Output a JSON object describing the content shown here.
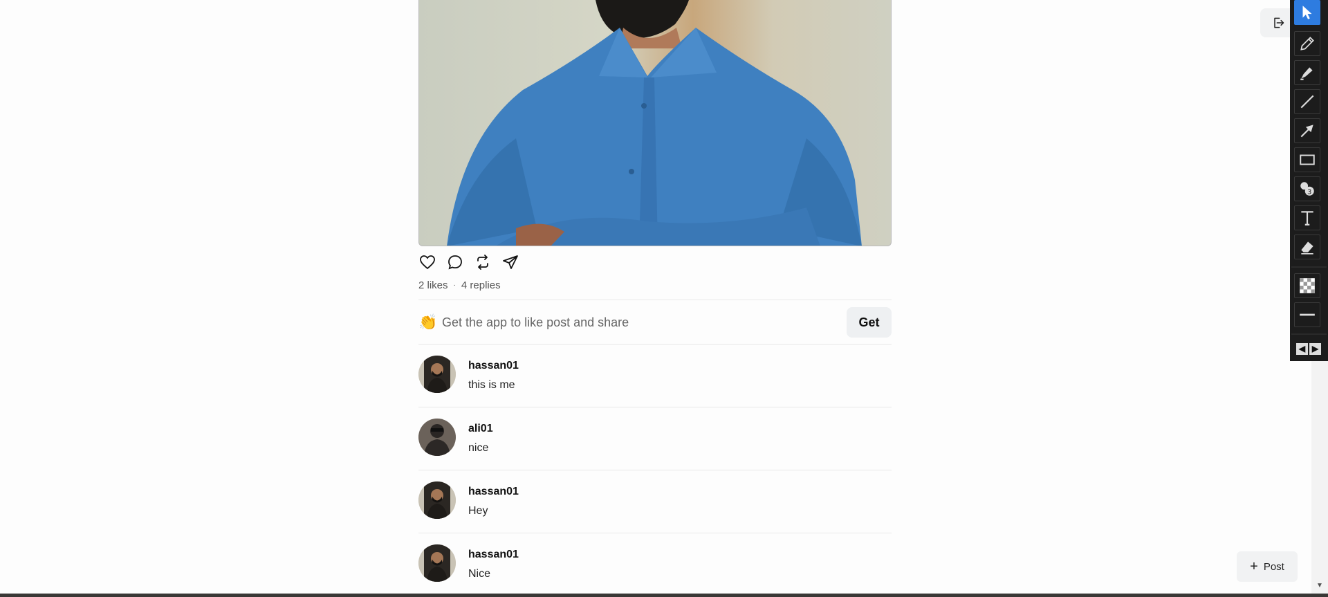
{
  "post": {
    "image_alt": "man in blue shirt with arms crossed",
    "likes_text": "2 likes",
    "separator": "·",
    "replies_text": "4 replies"
  },
  "actions": [
    {
      "icon": "heart-icon"
    },
    {
      "icon": "comment-icon"
    },
    {
      "icon": "repost-icon"
    },
    {
      "icon": "share-icon"
    }
  ],
  "get_app": {
    "emoji": "👏",
    "message": "Get the app to like post and share",
    "button_label": "Get"
  },
  "replies": [
    {
      "username": "hassan01",
      "text": "this is me"
    },
    {
      "username": "ali01",
      "text": "nice"
    },
    {
      "username": "hassan01",
      "text": "Hey"
    },
    {
      "username": "hassan01",
      "text": "Nice"
    }
  ],
  "toolbar": {
    "tools": [
      "select-icon",
      "pencil-icon",
      "highlighter-icon",
      "line-icon",
      "arrow-icon",
      "rectangle-icon",
      "counter-icon",
      "text-icon",
      "eraser-icon",
      "transparency-icon",
      "line-width-icon",
      "move-arrows-icon"
    ],
    "accent_color": "#2e7ce0"
  },
  "post_button": {
    "label": "Post",
    "icon": "plus-icon"
  }
}
